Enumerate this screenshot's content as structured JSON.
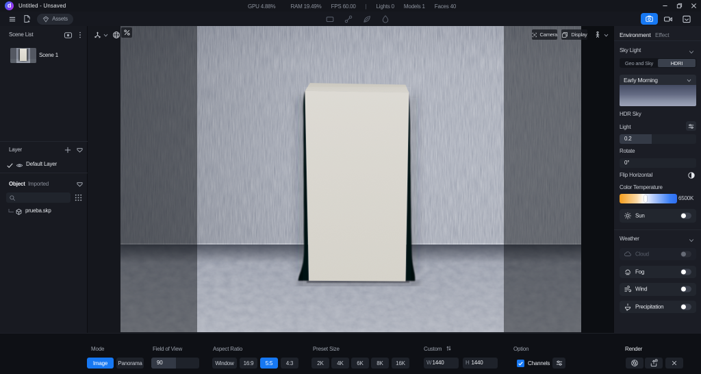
{
  "title_bar": {
    "title": "Untitled - Unsaved",
    "logo_glyph": "d",
    "stats": [
      "GPU 4.88%",
      "RAM 19.49%",
      "FPS 60.00",
      "Lights 0",
      "Models 1",
      "Faces 40"
    ],
    "stats_divider": "|"
  },
  "toolbar": {
    "assets_label": "Assets"
  },
  "left_panel": {
    "scene_list": {
      "title": "Scene List",
      "scenes": [
        {
          "name": "Scene 1"
        }
      ]
    },
    "layer": {
      "title": "Layer",
      "items": [
        {
          "name": "Default Layer"
        }
      ]
    },
    "object": {
      "title": "Object",
      "subtitle": "Imported",
      "items": [
        {
          "name": "prueba.skp"
        }
      ]
    }
  },
  "viewport": {
    "camera_label": "Camera",
    "display_label": "Display"
  },
  "right_panel": {
    "tabs": [
      "Environment",
      "Effect"
    ],
    "active_tab": "Environment",
    "sky_light": {
      "title": "Sky Light",
      "modes": [
        "Geo and Sky",
        "HDRI"
      ],
      "active_mode": "HDRI",
      "preset": "Early Morning",
      "hdr_sky_label": "HDR Sky",
      "light_label": "Light",
      "light_value": "0.2",
      "rotate_label": "Rotate",
      "rotate_value": "0°",
      "flip_label": "Flip Horizontal",
      "color_temp_label": "Color Temperature",
      "color_temp_value": "6500K",
      "sun_label": "Sun"
    },
    "weather": {
      "title": "Weather",
      "items": [
        {
          "label": "Cloud",
          "disabled": true,
          "on": false
        },
        {
          "label": "Fog",
          "disabled": false,
          "on": false
        },
        {
          "label": "Wind",
          "disabled": false,
          "on": false
        },
        {
          "label": "Precipitation",
          "disabled": false,
          "on": false
        }
      ]
    }
  },
  "bottom_bar": {
    "mode": {
      "label": "Mode",
      "options": [
        "Image",
        "Panorama"
      ],
      "active": "Image"
    },
    "fov": {
      "label": "Field of View",
      "value": "90"
    },
    "aspect": {
      "label": "Aspect Ratio",
      "options": [
        "Window",
        "16:9",
        "5:5",
        "4:3"
      ],
      "active": "5:5"
    },
    "preset": {
      "label": "Preset Size",
      "options": [
        "2K",
        "4K",
        "6K",
        "8K",
        "16K"
      ]
    },
    "custom": {
      "label": "Custom",
      "w_prefix": "W",
      "w_value": "1440",
      "h_prefix": "H",
      "h_value": "1440"
    },
    "option": {
      "label": "Option",
      "channels_label": "Channels",
      "channels_checked": true
    },
    "render": {
      "label": "Render"
    }
  },
  "colors": {
    "accent_blue": "#1778f2",
    "panel_bg": "#1b1d25",
    "bar_bg": "#0e1015",
    "temperature_left": "#f59d1c",
    "temperature_right": "#2e6ef2"
  }
}
